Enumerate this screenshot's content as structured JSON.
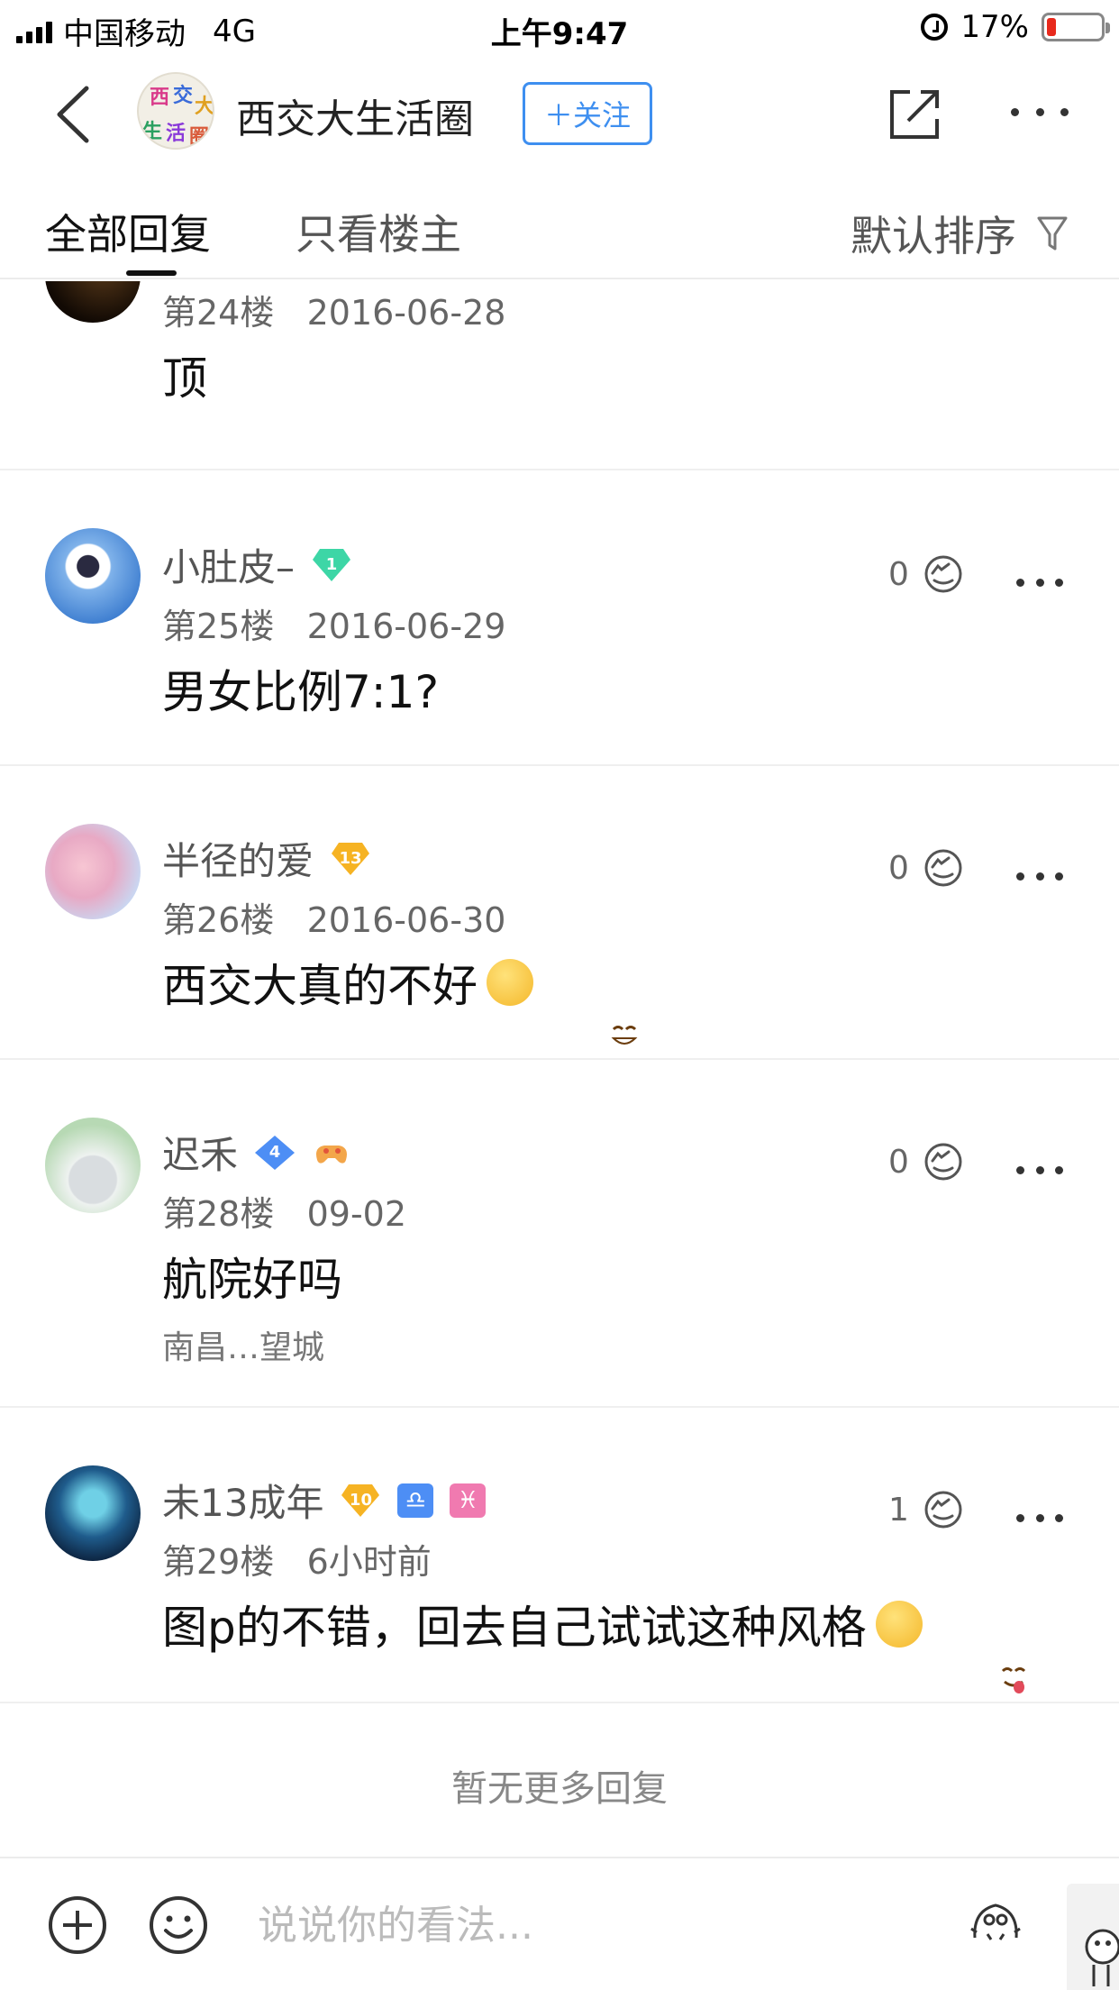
{
  "status_bar": {
    "carrier": "中国移动",
    "network": "4G",
    "time": "上午9:47",
    "battery_percent": "17%",
    "battery_level": 0.17
  },
  "nav": {
    "title": "西交大生活圈",
    "follow_label": "＋关注",
    "avatar_glyphs": [
      "西",
      "交",
      "大",
      "生",
      "活",
      "圈"
    ],
    "icons": [
      "back-icon",
      "share-icon",
      "more-icon"
    ]
  },
  "tabs": {
    "all_replies": "全部回复",
    "owner_only": "只看楼主",
    "sort_label": "默认排序"
  },
  "posts": [
    {
      "meta": "第24楼   2016-06-28",
      "text": "顶"
    },
    {
      "username": "小肚皮–",
      "badge_level": "1",
      "badge_color": "#3dd6a6",
      "meta": "第25楼   2016-06-29",
      "text": "男女比例7:1?",
      "likes": "0"
    },
    {
      "username": "半径的爱",
      "badge_level": "13",
      "badge_color": "#f6b323",
      "meta": "第26楼   2016-06-30",
      "text": "西交大真的不好",
      "likes": "0"
    },
    {
      "username": "迟禾",
      "badge_level": "4",
      "badge_color": "#4d8ef5",
      "meta": "第28楼   09-02",
      "text": "航院好吗",
      "location": "南昌…望城",
      "likes": "0"
    },
    {
      "username": "未13成年",
      "badge_level": "10",
      "badge_color": "#f6b323",
      "signs": [
        "♎",
        "♓"
      ],
      "sign_colors": [
        "#4d8ef5",
        "#f07ab0"
      ],
      "meta": "第29楼   6小时前",
      "text": "图p的不错，回去自己试试这种风格",
      "likes": "1"
    }
  ],
  "no_more_replies": "暂无更多回复",
  "comment_box": {
    "placeholder": "说说你的看法..."
  }
}
